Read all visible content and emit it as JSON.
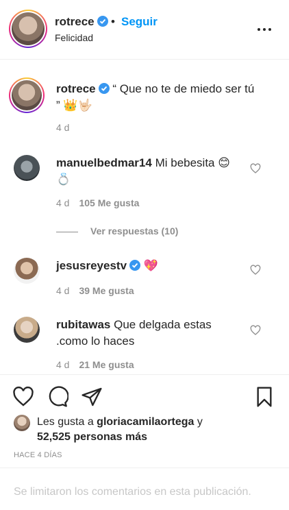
{
  "header": {
    "username": "rotrece",
    "separator": "•",
    "follow_label": "Seguir",
    "location": "Felicidad"
  },
  "caption": {
    "username": "rotrece",
    "text_line1": "“ Que no te de miedo ser tú",
    "text_line2": "”",
    "emojis": "👑🤟🏻",
    "age": "4 d"
  },
  "comments": [
    {
      "username": "manuelbedmar14",
      "text": "Mi bebesita",
      "emoji1": "😊",
      "emoji2": "💍",
      "age": "4 d",
      "likes": "105 Me gusta"
    },
    {
      "username": "jesusreyestv",
      "text": "",
      "emoji1": "💖",
      "age": "4 d",
      "likes": "39 Me gusta"
    },
    {
      "username": "rubitawas",
      "text": "Que delgada estas .como lo haces",
      "age": "4 d",
      "likes": "21 Me gusta"
    }
  ],
  "replies_label": "Ver respuestas (10)",
  "likes_summary": {
    "prefix": "Les gusta a ",
    "user": "gloriacamilaortega",
    "joiner": " y",
    "others": "52,525 personas más"
  },
  "post_time": "HACE 4 DÍAS",
  "footer_note": "Se limitaron los comentarios en esta publicación.",
  "colors": {
    "accent": "#0095f6",
    "text": "#262626",
    "muted": "#8e8e8e"
  }
}
